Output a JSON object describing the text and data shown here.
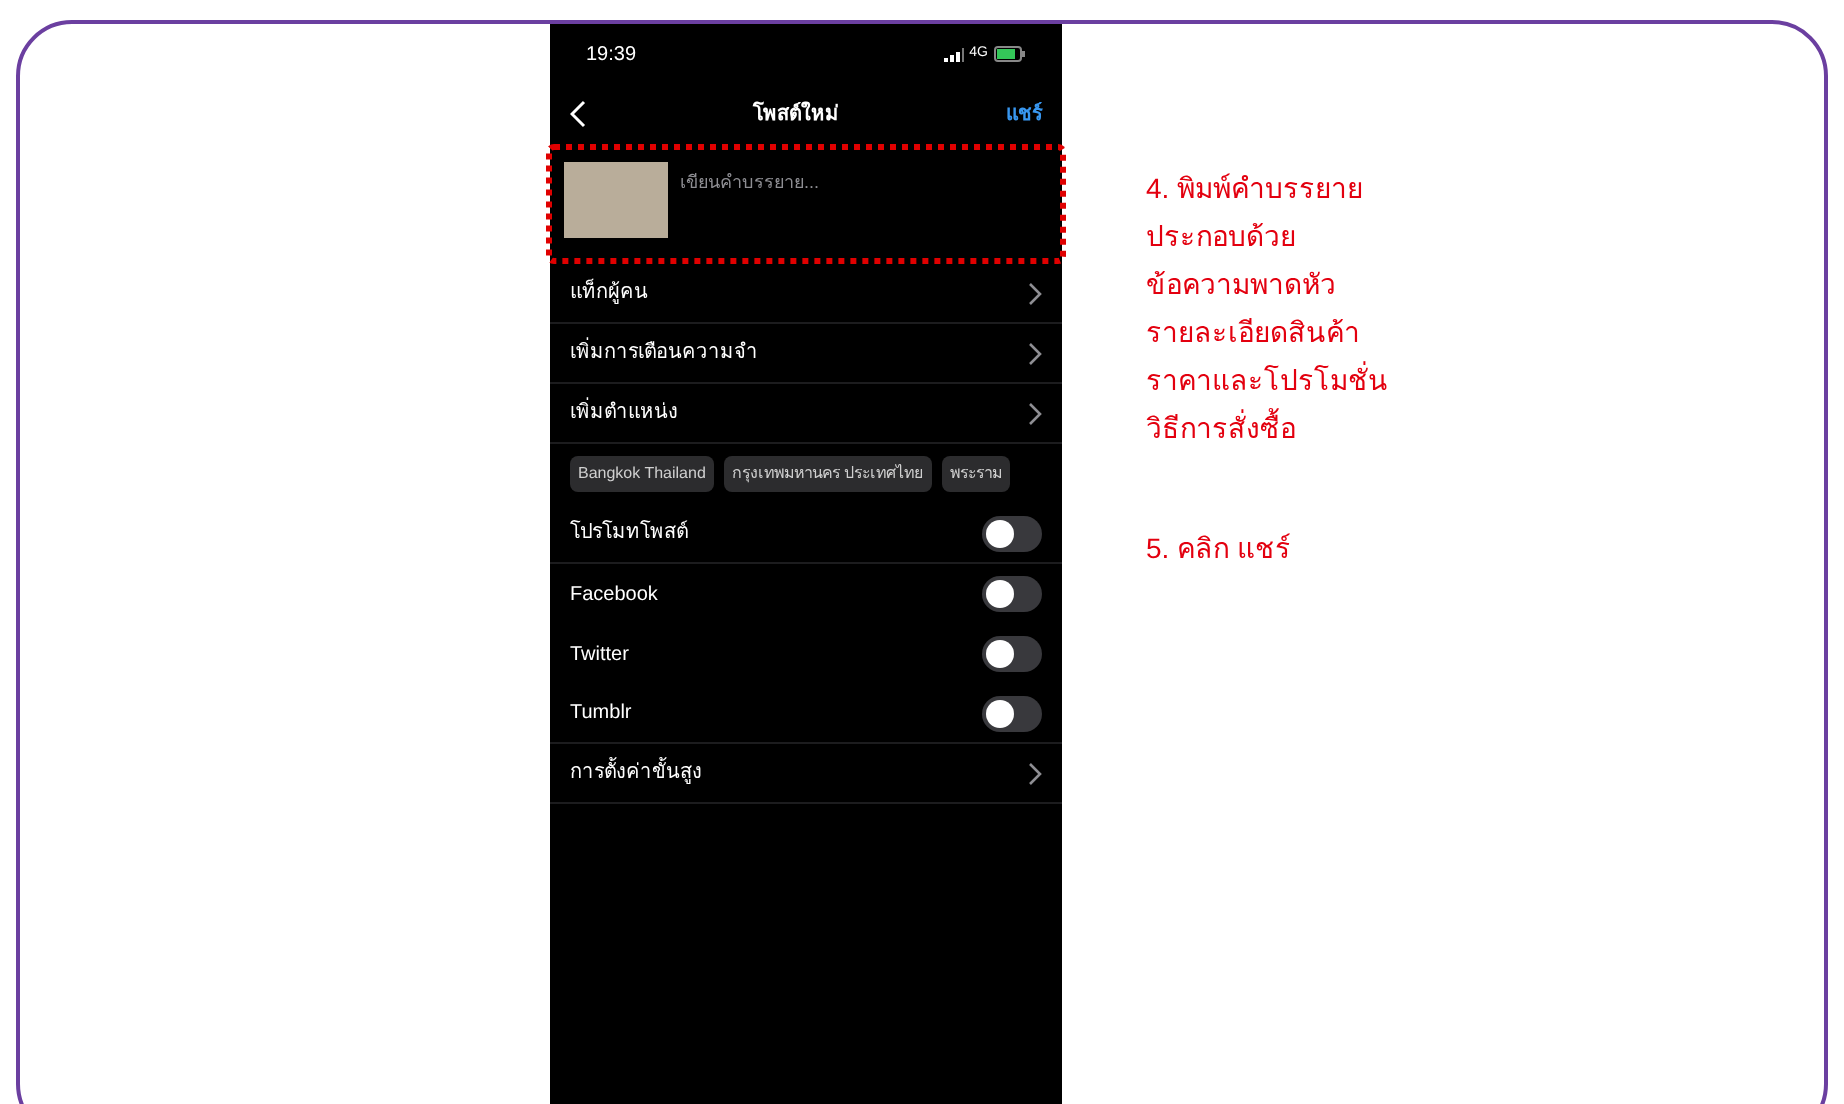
{
  "status_bar": {
    "time": "19:39",
    "network": "4G"
  },
  "nav": {
    "title": "โพสต์ใหม่",
    "action": "แชร์"
  },
  "caption": {
    "placeholder": "เขียนคำบรรยาย..."
  },
  "links": [
    {
      "label": "แท็กผู้คน"
    },
    {
      "label": "เพิ่มการเตือนความจำ"
    },
    {
      "label": "เพิ่มตำแหน่ง"
    }
  ],
  "location_chips": [
    "Bangkok Thailand",
    "กรุงเทพมหานคร ประเทศไทย",
    "พระราม"
  ],
  "toggles": [
    {
      "label": "โปรโมทโพสต์",
      "on": false
    },
    {
      "label": "Facebook",
      "on": false
    },
    {
      "label": "Twitter",
      "on": false
    },
    {
      "label": "Tumblr",
      "on": false
    }
  ],
  "advanced": {
    "label": "การตั้งค่าขั้นสูง"
  },
  "instructions": {
    "step_4": [
      "4. พิมพ์คำบรรยาย",
      "ประกอบด้วย",
      "ข้อความพาดหัว",
      "รายละเอียดสินค้า",
      "ราคาและโปรโมชั่น",
      "วิธีการสั่งซื้อ"
    ],
    "step_5": "5. คลิก แชร์"
  }
}
